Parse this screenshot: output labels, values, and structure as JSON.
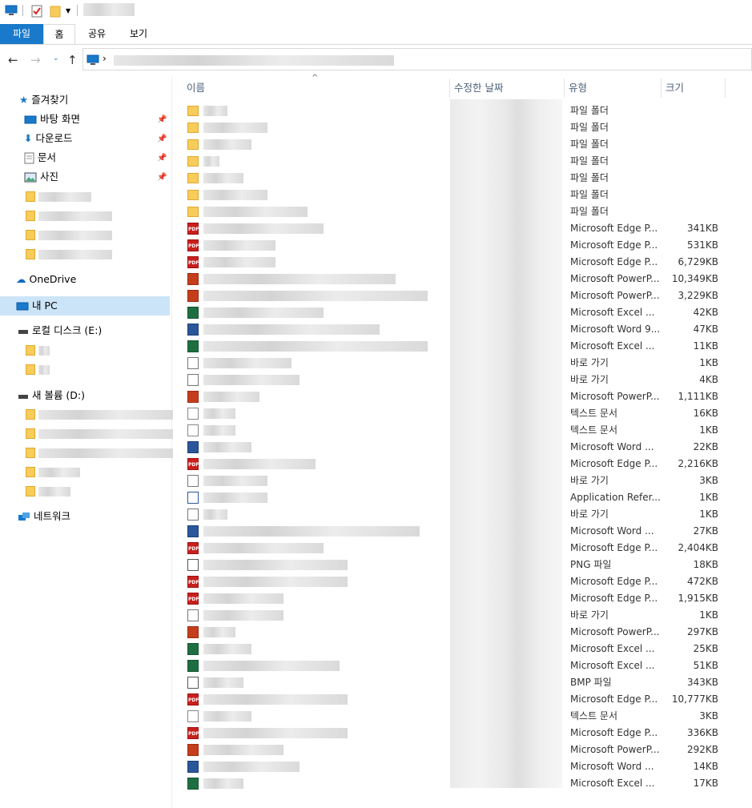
{
  "ribbon": {
    "tabs": [
      "파일",
      "홈",
      "공유",
      "보기"
    ]
  },
  "sidebar": {
    "quick_access": "즐겨찾기",
    "pinned": [
      "바탕 화면",
      "다운로드",
      "문서",
      "사진"
    ],
    "onedrive": "OneDrive",
    "this_pc": "내 PC",
    "drive_e": "로컬 디스크 (E:)",
    "drive_d": "새 볼륨 (D:)",
    "network": "네트워크"
  },
  "columns": {
    "name": "이름",
    "date": "수정한 날짜",
    "type": "유형",
    "size": "크기"
  },
  "files": [
    {
      "icon": "folder",
      "type": "파일 폴더",
      "size": ""
    },
    {
      "icon": "folder",
      "type": "파일 폴더",
      "size": ""
    },
    {
      "icon": "folder",
      "type": "파일 폴더",
      "size": ""
    },
    {
      "icon": "folder",
      "type": "파일 폴더",
      "size": ""
    },
    {
      "icon": "folder",
      "type": "파일 폴더",
      "size": ""
    },
    {
      "icon": "folder",
      "type": "파일 폴더",
      "size": ""
    },
    {
      "icon": "folder",
      "type": "파일 폴더",
      "size": ""
    },
    {
      "icon": "pdf",
      "type": "Microsoft Edge P...",
      "size": "341KB"
    },
    {
      "icon": "pdf",
      "type": "Microsoft Edge P...",
      "size": "531KB"
    },
    {
      "icon": "pdf",
      "type": "Microsoft Edge P...",
      "size": "6,729KB"
    },
    {
      "icon": "ppt",
      "type": "Microsoft PowerP...",
      "size": "10,349KB"
    },
    {
      "icon": "ppt",
      "type": "Microsoft PowerP...",
      "size": "3,229KB"
    },
    {
      "icon": "xls",
      "type": "Microsoft Excel ...",
      "size": "42KB"
    },
    {
      "icon": "doc",
      "type": "Microsoft Word 9...",
      "size": "47KB"
    },
    {
      "icon": "xls",
      "type": "Microsoft Excel ...",
      "size": "11KB"
    },
    {
      "icon": "lnk",
      "type": "바로 가기",
      "size": "1KB"
    },
    {
      "icon": "lnk",
      "type": "바로 가기",
      "size": "4KB"
    },
    {
      "icon": "ppt",
      "type": "Microsoft PowerP...",
      "size": "1,111KB"
    },
    {
      "icon": "txt",
      "type": "텍스트 문서",
      "size": "16KB"
    },
    {
      "icon": "txt",
      "type": "텍스트 문서",
      "size": "1KB"
    },
    {
      "icon": "doc",
      "type": "Microsoft Word ...",
      "size": "22KB"
    },
    {
      "icon": "pdf",
      "type": "Microsoft Edge P...",
      "size": "2,216KB"
    },
    {
      "icon": "lnk",
      "type": "바로 가기",
      "size": "3KB"
    },
    {
      "icon": "app",
      "type": "Application Refer...",
      "size": "1KB"
    },
    {
      "icon": "lnk",
      "type": "바로 가기",
      "size": "1KB"
    },
    {
      "icon": "doc",
      "type": "Microsoft Word ...",
      "size": "27KB"
    },
    {
      "icon": "pdf",
      "type": "Microsoft Edge P...",
      "size": "2,404KB"
    },
    {
      "icon": "img",
      "type": "PNG 파일",
      "size": "18KB"
    },
    {
      "icon": "pdf",
      "type": "Microsoft Edge P...",
      "size": "472KB"
    },
    {
      "icon": "pdf",
      "type": "Microsoft Edge P...",
      "size": "1,915KB"
    },
    {
      "icon": "lnk",
      "type": "바로 가기",
      "size": "1KB"
    },
    {
      "icon": "ppt",
      "type": "Microsoft PowerP...",
      "size": "297KB"
    },
    {
      "icon": "xls",
      "type": "Microsoft Excel ...",
      "size": "25KB"
    },
    {
      "icon": "xls",
      "type": "Microsoft Excel ...",
      "size": "51KB"
    },
    {
      "icon": "img",
      "type": "BMP 파일",
      "size": "343KB"
    },
    {
      "icon": "pdf",
      "type": "Microsoft Edge P...",
      "size": "10,777KB"
    },
    {
      "icon": "txt",
      "type": "텍스트 문서",
      "size": "3KB"
    },
    {
      "icon": "pdf",
      "type": "Microsoft Edge P...",
      "size": "336KB"
    },
    {
      "icon": "ppt",
      "type": "Microsoft PowerP...",
      "size": "292KB"
    },
    {
      "icon": "doc",
      "type": "Microsoft Word ...",
      "size": "14KB"
    },
    {
      "icon": "xls",
      "type": "Microsoft Excel ...",
      "size": "17KB"
    }
  ],
  "icon_labels": {
    "pdf": "PDF"
  },
  "colors": {
    "accent": "#1979ca",
    "folder": "#f8cc5a",
    "pdf": "#c8201e",
    "ppt": "#c43e1c",
    "xls": "#1d6f42",
    "doc": "#2b579a"
  }
}
